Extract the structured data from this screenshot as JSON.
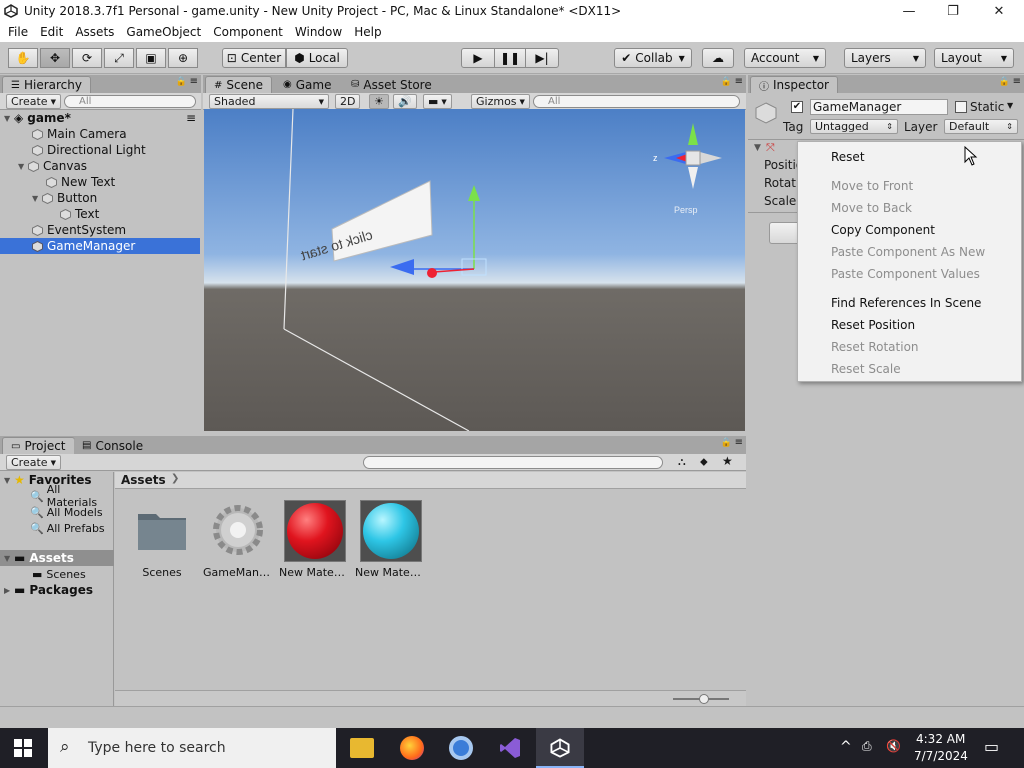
{
  "window": {
    "title": "Unity 2018.3.7f1 Personal - game.unity - New Unity Project - PC, Mac & Linux Standalone* <DX11>",
    "minimize": "—",
    "maximize": "❐",
    "close": "✕"
  },
  "menu": [
    "File",
    "Edit",
    "Assets",
    "GameObject",
    "Component",
    "Window",
    "Help"
  ],
  "toolbar": {
    "center": "Center",
    "local": "Local",
    "collab": "Collab",
    "account": "Account",
    "layers": "Layers",
    "layout": "Layout"
  },
  "hierarchy": {
    "tab": "Hierarchy",
    "create": "Create",
    "search_placeholder": "All",
    "scene": "game*",
    "items": [
      "Main Camera",
      "Directional Light",
      "Canvas",
      "New Text",
      "Button",
      "Text",
      "EventSystem",
      "GameManager"
    ],
    "selected": "GameManager"
  },
  "scene": {
    "tabs": [
      "Scene",
      "Game",
      "Asset Store"
    ],
    "shading": "Shaded",
    "mode2d": "2D",
    "gizmos": "Gizmos",
    "search_placeholder": "All",
    "button_text": "click to start",
    "persp_label": "Persp"
  },
  "inspector": {
    "tab": "Inspector",
    "object_name": "GameManager",
    "static_label": "Static",
    "tag_label": "Tag",
    "tag_value": "Untagged",
    "layer_label": "Layer",
    "layer_value": "Default",
    "rows": [
      "Positio",
      "Rotatio",
      "Scale"
    ]
  },
  "context_menu": {
    "items": [
      {
        "label": "Reset",
        "enabled": true
      },
      {
        "label": "Move to Front",
        "enabled": false
      },
      {
        "label": "Move to Back",
        "enabled": false
      },
      {
        "label": "Copy Component",
        "enabled": true
      },
      {
        "label": "Paste Component As New",
        "enabled": false
      },
      {
        "label": "Paste Component Values",
        "enabled": false
      },
      {
        "label": "Find References In Scene",
        "enabled": true
      },
      {
        "label": "Reset Position",
        "enabled": true
      },
      {
        "label": "Reset Rotation",
        "enabled": false
      },
      {
        "label": "Reset Scale",
        "enabled": false
      }
    ]
  },
  "project": {
    "tabs": [
      "Project",
      "Console"
    ],
    "create": "Create",
    "favorites": "Favorites",
    "favorite_items": [
      "All Materials",
      "All Models",
      "All Prefabs"
    ],
    "assets_root": "Assets",
    "assets_children": [
      "Scenes"
    ],
    "packages": "Packages",
    "breadcrumb": "Assets",
    "assets": [
      {
        "name": "Scenes",
        "kind": "folder"
      },
      {
        "name": "GameManager",
        "kind": "script"
      },
      {
        "name": "New Material",
        "kind": "material",
        "color": "#e0141e"
      },
      {
        "name": "New Material",
        "kind": "material",
        "color": "#2ec6e6"
      }
    ]
  },
  "taskbar": {
    "search_placeholder": "Type here to search",
    "time": "4:32 AM",
    "date": "7/7/2024"
  },
  "colors": {
    "selection": "#3a72d8",
    "panel_bg": "#c2c2c2",
    "taskbar_bg": "#1f1f26"
  }
}
